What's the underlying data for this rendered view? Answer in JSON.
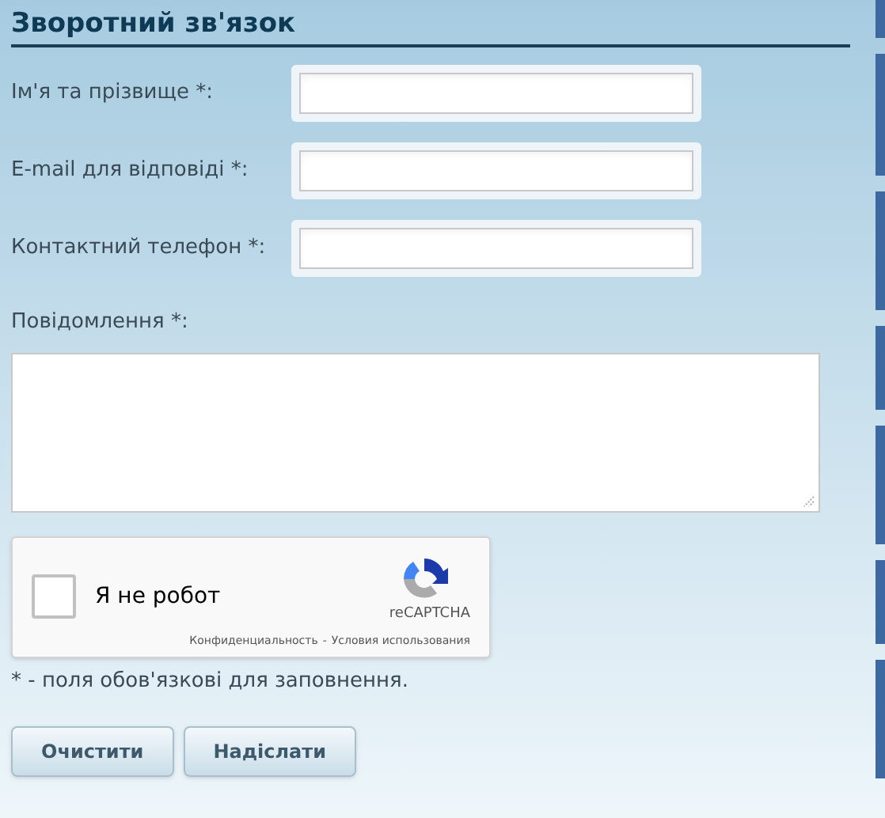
{
  "title": "Зворотний зв'язок",
  "fields": [
    {
      "label": "Ім'я та прізвище *:"
    },
    {
      "label": "E-mail для відповіді *:"
    },
    {
      "label": "Контактний телефон *:"
    }
  ],
  "message": {
    "label": "Повідомлення *:"
  },
  "captcha": {
    "label": "Я не робот",
    "checked": false,
    "brand": "reCAPTCHA",
    "privacy": "Конфиденциальность",
    "separator": "-",
    "terms": "Условия использования"
  },
  "note": "* - поля обов'язкові для заповнення.",
  "buttons": [
    "Очистити",
    "Надіслати"
  ]
}
